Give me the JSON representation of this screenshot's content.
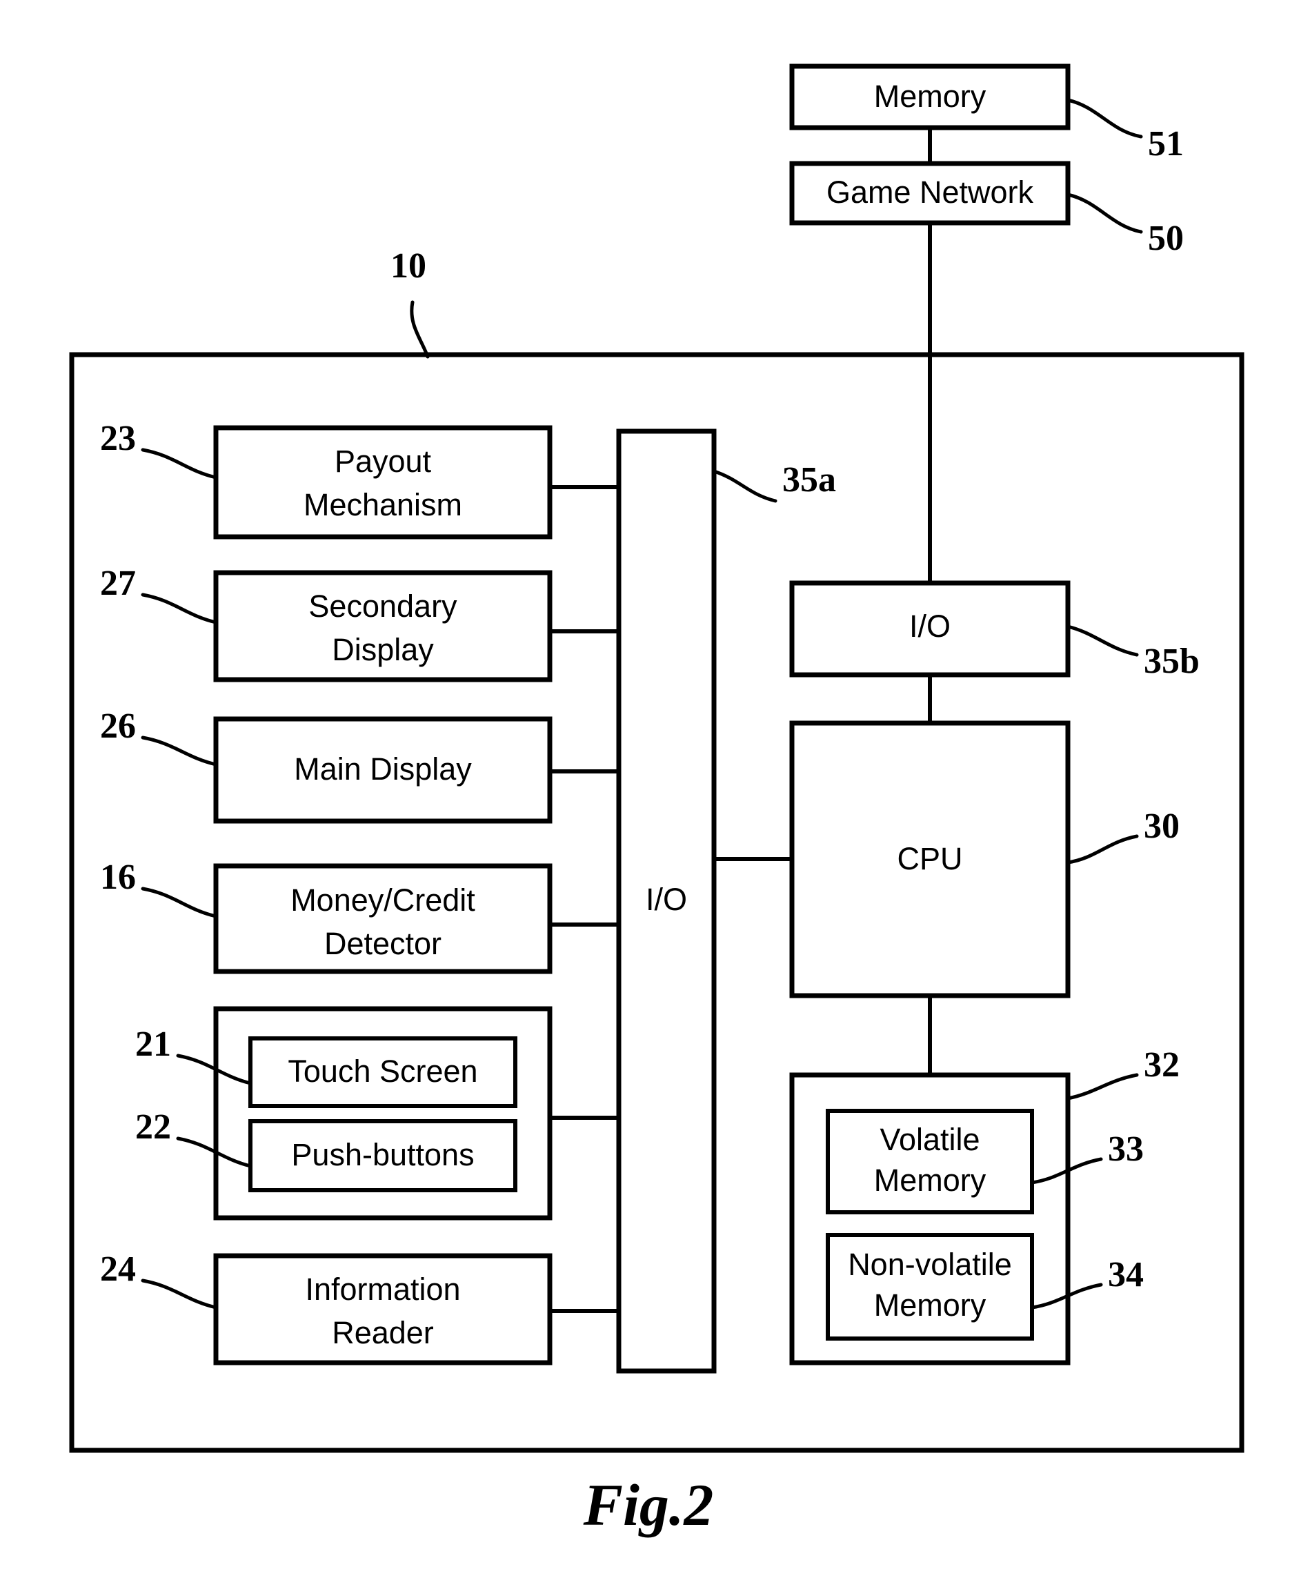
{
  "figure": {
    "caption": "Fig.2",
    "system_ref": "10"
  },
  "network_boxes": [
    {
      "label": "Memory",
      "ref": "51"
    },
    {
      "label": "Game Network",
      "ref": "50"
    }
  ],
  "peripheral_boxes": [
    {
      "label_line1": "Payout",
      "label_line2": "Mechanism",
      "ref": "23"
    },
    {
      "label_line1": "Secondary",
      "label_line2": "Display",
      "ref": "27"
    },
    {
      "label_line1": "Main Display",
      "label_line2": "",
      "ref": "26"
    },
    {
      "label_line1": "Money/Credit",
      "label_line2": "Detector",
      "ref": "16"
    },
    {
      "label_line1": "Information",
      "label_line2": "Reader",
      "ref": "24"
    }
  ],
  "input_group": {
    "items": [
      {
        "label": "Touch Screen",
        "ref": "21"
      },
      {
        "label": "Push-buttons",
        "ref": "22"
      }
    ]
  },
  "io_blocks": [
    {
      "label": "I/O",
      "ref": "35a"
    },
    {
      "label": "I/O",
      "ref": "35b"
    }
  ],
  "processor": {
    "label": "CPU",
    "ref": "30"
  },
  "memory_group": {
    "ref": "32",
    "items": [
      {
        "label_line1": "Volatile",
        "label_line2": "Memory",
        "ref": "33"
      },
      {
        "label_line1": "Non-volatile",
        "label_line2": "Memory",
        "ref": "34"
      }
    ]
  }
}
